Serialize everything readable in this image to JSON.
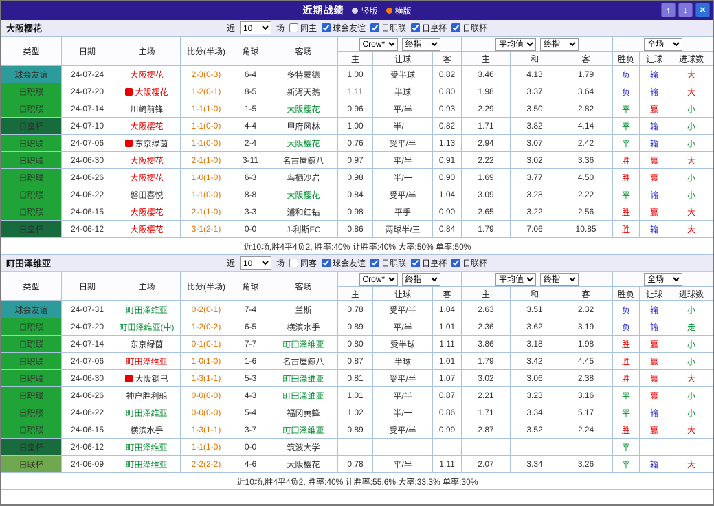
{
  "window": {
    "title": "近期战绩",
    "radios": [
      {
        "label": "竖版",
        "selected": false
      },
      {
        "label": "横版",
        "selected": true
      }
    ],
    "up_button": "↑",
    "down_button": "↓",
    "close_button": "×"
  },
  "colors": {
    "red": "#E60000",
    "green": "#009030",
    "blue": "#2525CD",
    "black": "#303030",
    "orange": "#E07300"
  },
  "columns": {
    "left": [
      "类型",
      "日期",
      "主场",
      "比分(半场)",
      "角球",
      "客场"
    ],
    "odds": [
      "主",
      "让球",
      "客",
      "主",
      "和",
      "客",
      "胜负",
      "让球",
      "进球数"
    ]
  },
  "sections": [
    {
      "team": "大阪樱花",
      "filter": {
        "near_label": "近",
        "count": "10",
        "games_label": "场",
        "same_option": {
          "label": "同主",
          "checked": false
        },
        "leagues": [
          {
            "label": "球会友谊",
            "checked": true
          },
          {
            "label": "日职联",
            "checked": true
          },
          {
            "label": "日皇杯",
            "checked": true
          },
          {
            "label": "日联杯",
            "checked": true
          }
        ]
      },
      "odds_selects": {
        "handicap": [
          "Crow*",
          "终指"
        ],
        "europe": [
          "平均值",
          "终指"
        ],
        "scope": [
          "全场"
        ]
      },
      "rows": [
        {
          "type": "球会友谊",
          "type_color": "#2E9B9B",
          "date": "24-07-24",
          "home": "大阪樱花",
          "home_color": "red",
          "home_badge": false,
          "score": "2-3(0-3)",
          "corner": "6-4",
          "away": "多特蒙德",
          "away_color": "black",
          "odds": [
            "1.00",
            "受半球",
            "0.82",
            "3.46",
            "4.13",
            "1.79"
          ],
          "result": "负",
          "result_color": "blue",
          "let": "输",
          "let_color": "blue",
          "goals": "大",
          "goals_color": "red"
        },
        {
          "type": "日职联",
          "type_color": "#21A437",
          "date": "24-07-20",
          "home": "大阪樱花",
          "home_color": "red",
          "home_badge": true,
          "score": "1-2(0-1)",
          "corner": "8-5",
          "away": "新泻天鹅",
          "away_color": "black",
          "odds": [
            "1.11",
            "半球",
            "0.80",
            "1.98",
            "3.37",
            "3.64"
          ],
          "result": "负",
          "result_color": "blue",
          "let": "输",
          "let_color": "blue",
          "goals": "大",
          "goals_color": "red"
        },
        {
          "type": "日职联",
          "type_color": "#21A437",
          "date": "24-07-14",
          "home": "川崎前锋",
          "home_color": "black",
          "home_badge": false,
          "score": "1-1(1-0)",
          "corner": "1-5",
          "away": "大阪樱花",
          "away_color": "green",
          "odds": [
            "0.96",
            "平/半",
            "0.93",
            "2.29",
            "3.50",
            "2.82"
          ],
          "result": "平",
          "result_color": "green",
          "let": "赢",
          "let_color": "red",
          "goals": "小",
          "goals_color": "green"
        },
        {
          "type": "日皇杯",
          "type_color": "#176B3C",
          "date": "24-07-10",
          "home": "大阪樱花",
          "home_color": "red",
          "home_badge": false,
          "score": "1-1(0-0)",
          "corner": "4-4",
          "away": "甲府风林",
          "away_color": "black",
          "odds": [
            "1.00",
            "半/一",
            "0.82",
            "1.71",
            "3.82",
            "4.14"
          ],
          "result": "平",
          "result_color": "green",
          "let": "输",
          "let_color": "blue",
          "goals": "小",
          "goals_color": "green"
        },
        {
          "type": "日职联",
          "type_color": "#21A437",
          "date": "24-07-06",
          "home": "东京绿茵",
          "home_color": "black",
          "home_badge": true,
          "score": "1-1(0-0)",
          "corner": "2-4",
          "away": "大阪樱花",
          "away_color": "green",
          "odds": [
            "0.76",
            "受平/半",
            "1.13",
            "2.94",
            "3.07",
            "2.42"
          ],
          "result": "平",
          "result_color": "green",
          "let": "输",
          "let_color": "blue",
          "goals": "小",
          "goals_color": "green"
        },
        {
          "type": "日职联",
          "type_color": "#21A437",
          "date": "24-06-30",
          "home": "大阪樱花",
          "home_color": "red",
          "home_badge": false,
          "score": "2-1(1-0)",
          "corner": "3-11",
          "away": "名古屋鲸八",
          "away_color": "black",
          "odds": [
            "0.97",
            "平/半",
            "0.91",
            "2.22",
            "3.02",
            "3.36"
          ],
          "result": "胜",
          "result_color": "red",
          "let": "赢",
          "let_color": "red",
          "goals": "大",
          "goals_color": "red"
        },
        {
          "type": "日职联",
          "type_color": "#21A437",
          "date": "24-06-26",
          "home": "大阪樱花",
          "home_color": "red",
          "home_badge": false,
          "score": "1-0(1-0)",
          "corner": "6-3",
          "away": "鸟栖沙岩",
          "away_color": "black",
          "odds": [
            "0.98",
            "半/一",
            "0.90",
            "1.69",
            "3.77",
            "4.50"
          ],
          "result": "胜",
          "result_color": "red",
          "let": "赢",
          "let_color": "red",
          "goals": "小",
          "goals_color": "green"
        },
        {
          "type": "日职联",
          "type_color": "#21A437",
          "date": "24-06-22",
          "home": "磐田喜悦",
          "home_color": "black",
          "home_badge": false,
          "score": "1-1(0-0)",
          "corner": "8-8",
          "away": "大阪樱花",
          "away_color": "green",
          "odds": [
            "0.84",
            "受平/半",
            "1.04",
            "3.09",
            "3.28",
            "2.22"
          ],
          "result": "平",
          "result_color": "green",
          "let": "输",
          "let_color": "blue",
          "goals": "小",
          "goals_color": "green"
        },
        {
          "type": "日职联",
          "type_color": "#21A437",
          "date": "24-06-15",
          "home": "大阪樱花",
          "home_color": "red",
          "home_badge": false,
          "score": "2-1(1-0)",
          "corner": "3-3",
          "away": "浦和红钻",
          "away_color": "black",
          "odds": [
            "0.98",
            "平手",
            "0.90",
            "2.65",
            "3.22",
            "2.56"
          ],
          "result": "胜",
          "result_color": "red",
          "let": "赢",
          "let_color": "red",
          "goals": "大",
          "goals_color": "red"
        },
        {
          "type": "日皇杯",
          "type_color": "#176B3C",
          "date": "24-06-12",
          "home": "大阪樱花",
          "home_color": "red",
          "home_badge": false,
          "score": "3-1(2-1)",
          "corner": "0-0",
          "away": "J-利斯FC",
          "away_color": "black",
          "odds": [
            "0.86",
            "两球半/三",
            "0.84",
            "1.79",
            "7.06",
            "10.85"
          ],
          "result": "胜",
          "result_color": "red",
          "let": "输",
          "let_color": "blue",
          "goals": "大",
          "goals_color": "red"
        }
      ],
      "summary": "近10场,胜4平4负2, 胜率:40%  让胜率:40%  大率:50%  单率:50%"
    },
    {
      "team": "町田泽维亚",
      "filter": {
        "near_label": "近",
        "count": "10",
        "games_label": "场",
        "same_option": {
          "label": "同客",
          "checked": false
        },
        "leagues": [
          {
            "label": "球会友谊",
            "checked": true
          },
          {
            "label": "日职联",
            "checked": true
          },
          {
            "label": "日皇杯",
            "checked": true
          },
          {
            "label": "日联杯",
            "checked": true
          }
        ]
      },
      "odds_selects": {
        "handicap": [
          "Crow*",
          "终指"
        ],
        "europe": [
          "平均值",
          "终指"
        ],
        "scope": [
          "全场"
        ]
      },
      "rows": [
        {
          "type": "球会友谊",
          "type_color": "#2E9B9B",
          "date": "24-07-31",
          "home": "町田泽维亚",
          "home_color": "green",
          "home_badge": false,
          "score": "0-2(0-1)",
          "corner": "7-4",
          "away": "兰斯",
          "away_color": "black",
          "odds": [
            "0.78",
            "受平/半",
            "1.04",
            "2.63",
            "3.51",
            "2.32"
          ],
          "result": "负",
          "result_color": "blue",
          "let": "输",
          "let_color": "blue",
          "goals": "小",
          "goals_color": "green"
        },
        {
          "type": "日职联",
          "type_color": "#21A437",
          "date": "24-07-20",
          "home": "町田泽维亚(中)",
          "home_color": "green",
          "home_badge": false,
          "score": "1-2(0-2)",
          "corner": "6-5",
          "away": "横滨水手",
          "away_color": "black",
          "odds": [
            "0.89",
            "平/半",
            "1.01",
            "2.36",
            "3.62",
            "3.19"
          ],
          "result": "负",
          "result_color": "blue",
          "let": "输",
          "let_color": "blue",
          "goals": "走",
          "goals_color": "green"
        },
        {
          "type": "日职联",
          "type_color": "#21A437",
          "date": "24-07-14",
          "home": "东京绿茵",
          "home_color": "black",
          "home_badge": false,
          "score": "0-1(0-1)",
          "corner": "7-7",
          "away": "町田泽维亚",
          "away_color": "green",
          "odds": [
            "0.80",
            "受半球",
            "1.11",
            "3.86",
            "3.18",
            "1.98"
          ],
          "result": "胜",
          "result_color": "red",
          "let": "赢",
          "let_color": "red",
          "goals": "小",
          "goals_color": "green"
        },
        {
          "type": "日职联",
          "type_color": "#21A437",
          "date": "24-07-06",
          "home": "町田泽维亚",
          "home_color": "red",
          "home_badge": false,
          "score": "1-0(1-0)",
          "corner": "1-6",
          "away": "名古屋鲸八",
          "away_color": "black",
          "odds": [
            "0.87",
            "半球",
            "1.01",
            "1.79",
            "3.42",
            "4.45"
          ],
          "result": "胜",
          "result_color": "red",
          "let": "赢",
          "let_color": "red",
          "goals": "小",
          "goals_color": "green"
        },
        {
          "type": "日职联",
          "type_color": "#21A437",
          "date": "24-06-30",
          "home": "大阪钢巴",
          "home_color": "black",
          "home_badge": true,
          "score": "1-3(1-1)",
          "corner": "5-3",
          "away": "町田泽维亚",
          "away_color": "green",
          "odds": [
            "0.81",
            "受平/半",
            "1.07",
            "3.02",
            "3.06",
            "2.38"
          ],
          "result": "胜",
          "result_color": "red",
          "let": "赢",
          "let_color": "red",
          "goals": "大",
          "goals_color": "red"
        },
        {
          "type": "日职联",
          "type_color": "#21A437",
          "date": "24-06-26",
          "home": "神户胜利船",
          "home_color": "black",
          "home_badge": false,
          "score": "0-0(0-0)",
          "corner": "4-3",
          "away": "町田泽维亚",
          "away_color": "green",
          "odds": [
            "1.01",
            "平/半",
            "0.87",
            "2.21",
            "3.23",
            "3.16"
          ],
          "result": "平",
          "result_color": "green",
          "let": "赢",
          "let_color": "red",
          "goals": "小",
          "goals_color": "green"
        },
        {
          "type": "日职联",
          "type_color": "#21A437",
          "date": "24-06-22",
          "home": "町田泽维亚",
          "home_color": "green",
          "home_badge": false,
          "score": "0-0(0-0)",
          "corner": "5-4",
          "away": "福冈黄蜂",
          "away_color": "black",
          "odds": [
            "1.02",
            "半/一",
            "0.86",
            "1.71",
            "3.34",
            "5.17"
          ],
          "result": "平",
          "result_color": "green",
          "let": "输",
          "let_color": "blue",
          "goals": "小",
          "goals_color": "green"
        },
        {
          "type": "日职联",
          "type_color": "#21A437",
          "date": "24-06-15",
          "home": "横滨水手",
          "home_color": "black",
          "home_badge": false,
          "score": "1-3(1-1)",
          "corner": "3-7",
          "away": "町田泽维亚",
          "away_color": "green",
          "odds": [
            "0.89",
            "受平/半",
            "0.99",
            "2.87",
            "3.52",
            "2.24"
          ],
          "result": "胜",
          "result_color": "red",
          "let": "赢",
          "let_color": "red",
          "goals": "大",
          "goals_color": "red"
        },
        {
          "type": "日皇杯",
          "type_color": "#176B3C",
          "date": "24-06-12",
          "home": "町田泽维亚",
          "home_color": "green",
          "home_badge": false,
          "score": "1-1(1-0)",
          "corner": "0-0",
          "away": "筑波大学",
          "away_color": "black",
          "odds": [
            "",
            "",
            "",
            "",
            "",
            ""
          ],
          "result": "平",
          "result_color": "green",
          "let": "",
          "let_color": "black",
          "goals": "",
          "goals_color": "black"
        },
        {
          "type": "日联杯",
          "type_color": "#6FA84D",
          "date": "24-06-09",
          "home": "町田泽维亚",
          "home_color": "green",
          "home_badge": false,
          "score": "2-2(2-2)",
          "corner": "4-6",
          "away": "大阪樱花",
          "away_color": "black",
          "odds": [
            "0.78",
            "平/半",
            "1.11",
            "2.07",
            "3.34",
            "3.26"
          ],
          "result": "平",
          "result_color": "green",
          "let": "输",
          "let_color": "blue",
          "goals": "大",
          "goals_color": "red"
        }
      ],
      "summary": "近10场,胜4平4负2, 胜率:40%  让胜率:55.6%  大率:33.3%  单率:30%"
    }
  ]
}
